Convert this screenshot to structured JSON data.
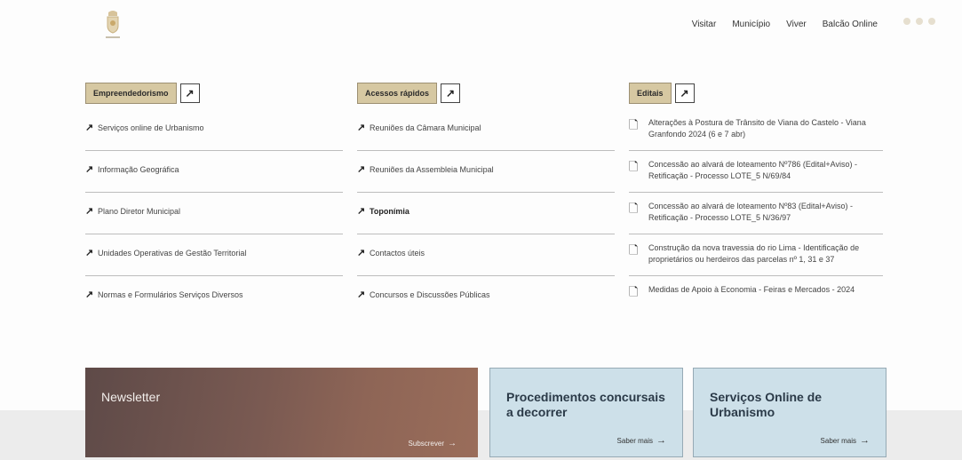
{
  "nav": {
    "items": [
      "Visitar",
      "Município",
      "Viver",
      "Balcão Online"
    ]
  },
  "columns": [
    {
      "tag": "Empreendedorismo",
      "items": [
        "Serviços online de Urbanismo",
        "Informação Geográfica",
        "Plano Diretor Municipal",
        "Unidades Operativas de Gestão Territorial",
        "Normas e Formulários Serviços Diversos"
      ]
    },
    {
      "tag": "Acessos rápidos",
      "items": [
        "Reuniões da Câmara Municipal",
        "Reuniões da Assembleia Municipal",
        "Toponímia",
        "Contactos úteis",
        "Concursos e Discussões Públicas"
      ]
    },
    {
      "tag": "Editais",
      "items": [
        "Alterações à Postura de Trânsito de Viana do Castelo - Viana Granfondo 2024 (6 e 7 abr)",
        "Concessão ao alvará de loteamento Nº786 (Edital+Aviso) - Retificação - Processo LOTE_5 N/69/84",
        "Concessão ao alvará de loteamento Nº83 (Edital+Aviso) - Retificação - Processo LOTE_5 N/36/97",
        "Construção da nova travessia do rio Lima - Identificação de proprietários ou herdeiros das parcelas nº 1, 31 e 37",
        "Medidas de Apoio à Economia - Feiras e Mercados - 2024"
      ]
    }
  ],
  "cards": {
    "newsletter": {
      "title": "Newsletter",
      "cta": "Subscrever"
    },
    "procedimentos": {
      "title": "Procedimentos concursais a decorrer",
      "cta": "Saber mais"
    },
    "servicos": {
      "title": "Serviços Online de Urbanismo",
      "cta": "Saber mais"
    }
  }
}
